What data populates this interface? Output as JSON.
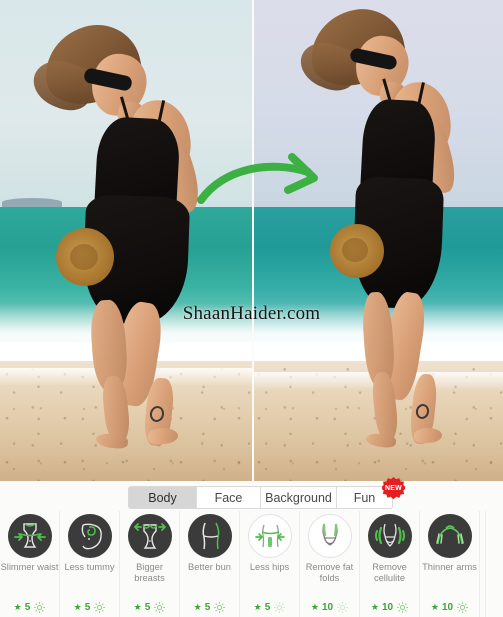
{
  "app": {
    "watermark": "ShaanHaider.com",
    "accent_green": "#3aa832",
    "arrow_green": "#3cb043",
    "badge_red": "#e41f21",
    "circle_dark": "#3b3b3b"
  },
  "preview": {
    "before_label": "before-photo",
    "after_label": "after-photo",
    "arrow_icon": "curved-arrow-icon"
  },
  "tabs": [
    {
      "label": "Body",
      "active": true,
      "badge": ""
    },
    {
      "label": "Face",
      "active": false,
      "badge": ""
    },
    {
      "label": "Background",
      "active": false,
      "badge": ""
    },
    {
      "label": "Fun",
      "active": false,
      "badge": "NEW"
    }
  ],
  "badge": {
    "new_label": "NEW"
  },
  "tools": [
    {
      "name": "slimmer-waist",
      "label": "Slimmer waist",
      "icon": "waist-slim-icon",
      "price": "5",
      "star": "★",
      "selected": true
    },
    {
      "name": "less-tummy",
      "label": "Less tummy",
      "icon": "tummy-icon",
      "price": "5",
      "star": "★",
      "selected": true
    },
    {
      "name": "bigger-breasts",
      "label": "Bigger breasts",
      "icon": "breasts-icon",
      "price": "5",
      "star": "★",
      "selected": true
    },
    {
      "name": "better-bun",
      "label": "Better bun",
      "icon": "bun-icon",
      "price": "5",
      "star": "★",
      "selected": true
    },
    {
      "name": "less-hips",
      "label": "Less hips",
      "icon": "hips-icon",
      "price": "5",
      "star": "★",
      "selected": false
    },
    {
      "name": "remove-fat-folds",
      "label": "Remove fat folds",
      "icon": "fat-folds-icon",
      "price": "10",
      "star": "★",
      "selected": false
    },
    {
      "name": "remove-cellulite",
      "label": "Remove cellulite",
      "icon": "cellulite-icon",
      "price": "10",
      "star": "★",
      "selected": true
    },
    {
      "name": "thinner-arms",
      "label": "Thinner arms",
      "icon": "arms-icon",
      "price": "10",
      "star": "★",
      "selected": true
    }
  ]
}
